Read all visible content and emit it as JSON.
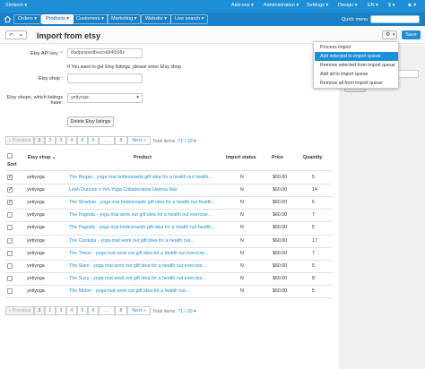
{
  "topbar": {
    "brand": "Simtech",
    "right_items": [
      "Add-ons",
      "Administration",
      "Settings",
      "Design",
      "EN",
      "$"
    ]
  },
  "nav": {
    "items": [
      "Orders",
      "Products",
      "Customers",
      "Marketing",
      "Website",
      "Live search"
    ],
    "active_index": 1,
    "quick_menu": "Quick menu"
  },
  "header": {
    "title": "Import from etsy",
    "save_label": "Save"
  },
  "dropdown": {
    "items": [
      "Process import",
      "Add selected to import queue",
      "Remove selected from import queue",
      "Add all to import queue",
      "Remove all from import queue"
    ],
    "active_index": 1
  },
  "form": {
    "api_key_label": "Etsy API key :",
    "api_key_value": "8adpyspedbvuca0t40i98z",
    "etsy_shop_help": "If You want to get Etsy listings, please enter Etsy shop",
    "etsy_shop_label": "Etsy shop :",
    "etsy_shop_value": "",
    "shops_label_1": "Etsy shops, which listings",
    "shops_label_2": "have:",
    "shops_value": "yetiyoga",
    "delete_label": "Delete Etsy listings"
  },
  "pagination": {
    "prev": "« Previous",
    "pages": [
      "1",
      "2",
      "3",
      "4",
      "5",
      "6",
      "...",
      "8"
    ],
    "current": "1",
    "next": "Next »",
    "total_label": "Total items:",
    "total_value": "71",
    "sep": "/",
    "per_page": "10"
  },
  "table": {
    "columns": [
      "Sort",
      "Etsy shop",
      "Product",
      "Import status",
      "Price",
      "Quantity"
    ],
    "sort_indicator": "⌄",
    "rows": [
      {
        "checked": true,
        "shop": "yetiyoga",
        "product": "The Regan - yoga mat bridesmaids gift idea for a health nut health...",
        "status": "N",
        "price": "$60.00",
        "qty": "5"
      },
      {
        "checked": true,
        "shop": "yetiyoga",
        "product": "Leah Duncan x Yeti Yoga Collaboration Hamsa Mat",
        "status": "N",
        "price": "$60.00",
        "qty": "14"
      },
      {
        "checked": true,
        "shop": "yetiyoga",
        "product": "The Shadow - yoga mat bridesmaids gift idea for a health nut health...",
        "status": "N",
        "price": "$60.00",
        "qty": "5"
      },
      {
        "checked": false,
        "shop": "yetiyoga",
        "product": "The Pagoda - yoga mat work out gift idea for a health nut exercise...",
        "status": "N",
        "price": "$60.00",
        "qty": "7"
      },
      {
        "checked": false,
        "shop": "yetiyoga",
        "product": "The Pagoda - yoga mat bridesmaids gift idea for a health nut health...",
        "status": "N",
        "price": "$60.00",
        "qty": "5"
      },
      {
        "checked": false,
        "shop": "yetiyoga",
        "product": "The Cordelia - yoga mat work out gift idea for a health nut...",
        "status": "N",
        "price": "$60.00",
        "qty": "17"
      },
      {
        "checked": false,
        "shop": "yetiyoga",
        "product": "The Timon - yoga mat work out gift idea for a health nut exercise...",
        "status": "N",
        "price": "$60.00",
        "qty": "7"
      },
      {
        "checked": false,
        "shop": "yetiyoga",
        "product": "The Siani - yoga mat work out gift idea for a health nut exercise...",
        "status": "N",
        "price": "$60.00",
        "qty": "5"
      },
      {
        "checked": false,
        "shop": "yetiyoga",
        "product": "The Suzy - yoga mat work out gift idea for a health nut exercise...",
        "status": "N",
        "price": "$60.00",
        "qty": "8"
      },
      {
        "checked": false,
        "shop": "yetiyoga",
        "product": "The Midori - yoga mat work out gift idea for a health nut...",
        "status": "N",
        "price": "$60.00",
        "qty": "5"
      }
    ]
  },
  "colors": {
    "topbar": "#1e8fd6",
    "navbar": "#1a7fc4",
    "accent": "#1e8fd6",
    "link": "#1e8fd6"
  },
  "icons": {
    "home": "home-icon",
    "back": "arrow-left-icon",
    "caret": "chevron-down-icon",
    "gear": "gear-icon"
  }
}
